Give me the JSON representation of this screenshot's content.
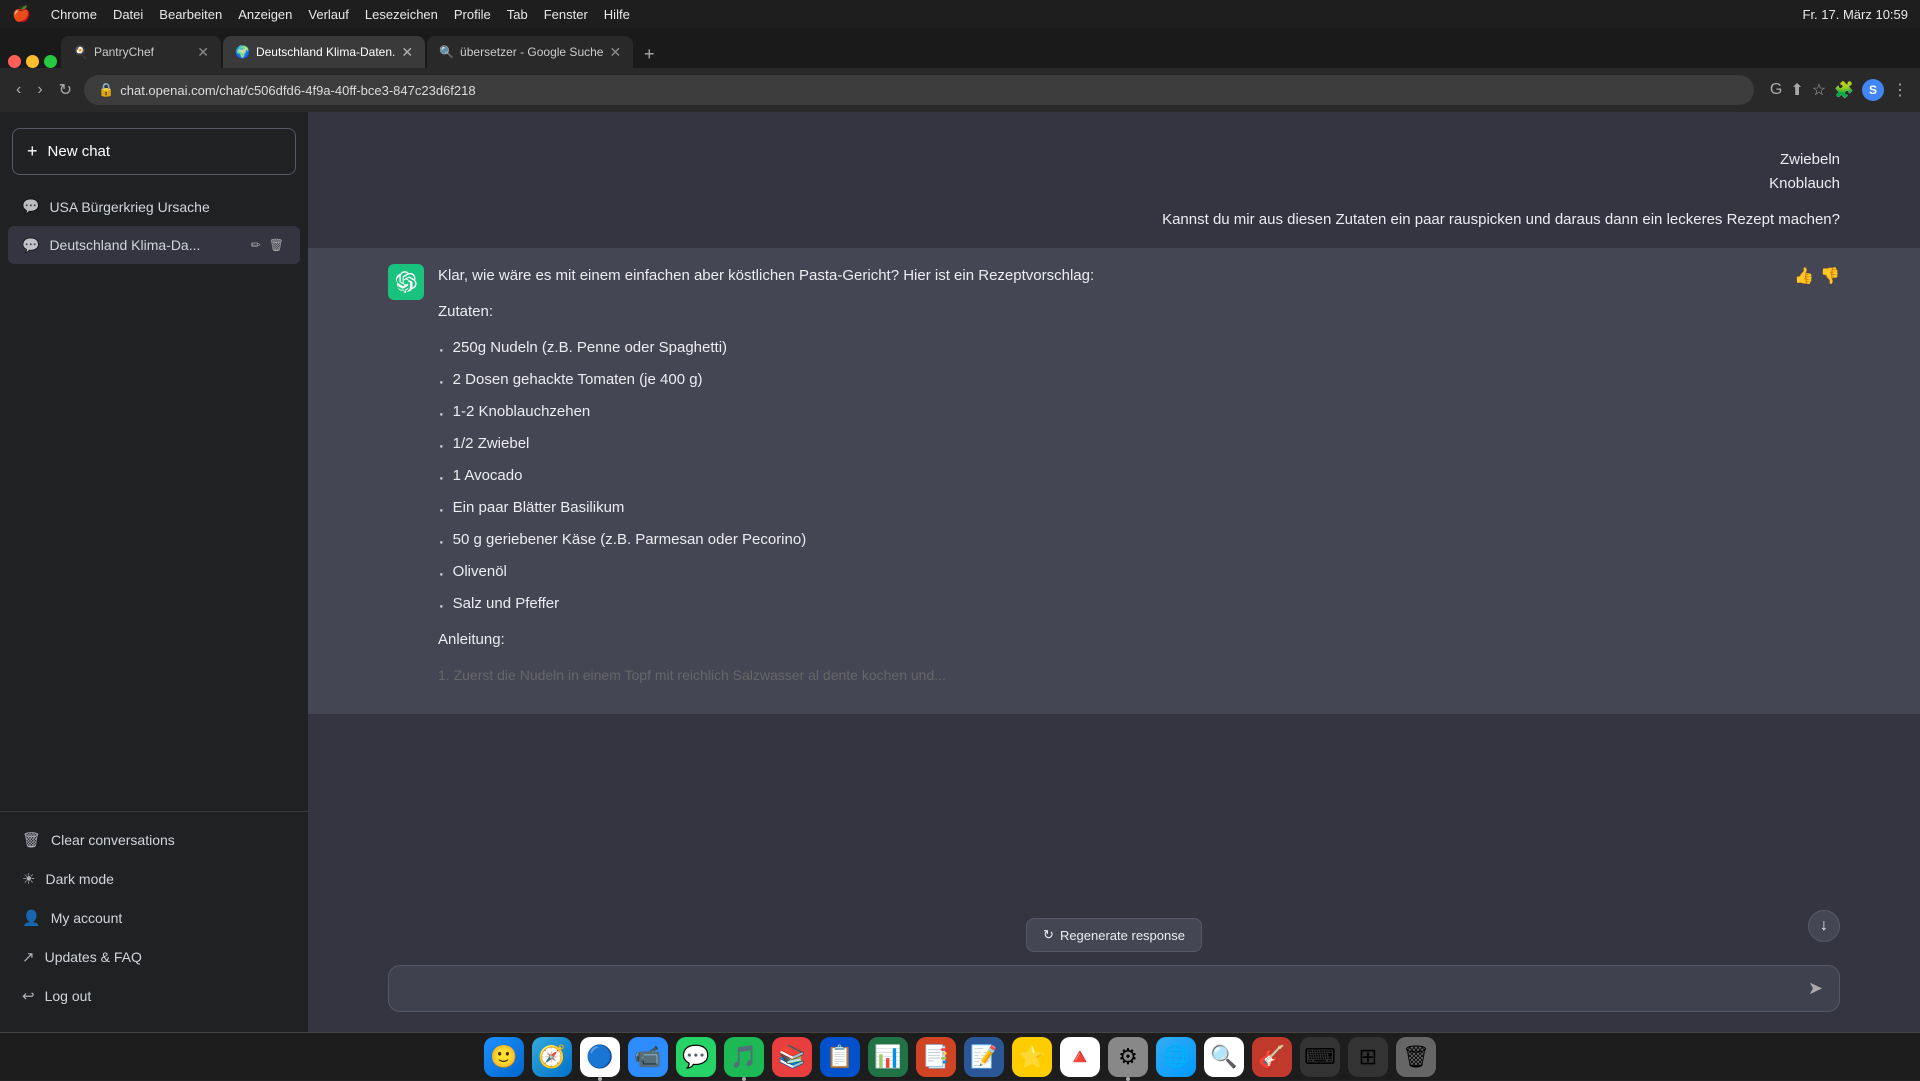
{
  "menubar": {
    "apple": "🍎",
    "items": [
      "Chrome",
      "Datei",
      "Bearbeiten",
      "Anzeigen",
      "Verlauf",
      "Lesezeichen",
      "Profile",
      "Tab",
      "Fenster",
      "Hilfe"
    ],
    "right": "Fr. 17. März  10:59"
  },
  "browser": {
    "tabs": [
      {
        "id": "pantry",
        "title": "PantryChef",
        "active": false,
        "favicon": "🍳"
      },
      {
        "id": "klima",
        "title": "Deutschland Klima-Daten.",
        "active": true,
        "favicon": "🌍"
      },
      {
        "id": "uebersetzer",
        "title": "übersetzer - Google Suche",
        "active": false,
        "favicon": "🔍"
      }
    ],
    "url": "chat.openai.com/chat/c506dfd6-4f9a-40ff-bce3-847c23d6f218"
  },
  "sidebar": {
    "new_chat_label": "New chat",
    "chats": [
      {
        "id": "usa",
        "title": "USA Bürgerkrieg Ursache",
        "active": false
      },
      {
        "id": "deutschland",
        "title": "Deutschland Klima-Da...",
        "active": true
      }
    ],
    "bottom_items": [
      {
        "id": "clear",
        "icon": "🗑",
        "label": "Clear conversations"
      },
      {
        "id": "dark",
        "icon": "☀",
        "label": "Dark mode"
      },
      {
        "id": "account",
        "icon": "👤",
        "label": "My account"
      },
      {
        "id": "updates",
        "icon": "↗",
        "label": "Updates & FAQ"
      },
      {
        "id": "logout",
        "icon": "↩",
        "label": "Log out"
      }
    ]
  },
  "chat": {
    "user_message": "Zwiebeln\nKnoblauch\n\nKannst du mir aus diesen Zutaten ein paar rauspicken und daraus dann ein leckeres Rezept machen?",
    "assistant_message": {
      "intro": "Klar, wie wäre es mit einem einfachen aber köstlichen Pasta-Gericht? Hier ist ein Rezeptvorschlag:",
      "zutaten_label": "Zutaten:",
      "ingredients": [
        "250g Nudeln (z.B. Penne oder Spaghetti)",
        "2 Dosen gehackte Tomaten (je 400 g)",
        "1-2 Knoblauchzehen",
        "1/2 Zwiebel",
        "1 Avocado",
        "Ein paar Blätter Basilikum",
        "50 g geriebener Käse (z.B. Parmesan oder Pecorino)",
        "Olivenöl",
        "Salz und Pfeffer"
      ],
      "anleitung_label": "Anleitung:",
      "partial_step": "1.  Zuerst die Nudeln in einem Topf mit reichlich Salzwasser al dente kochen und..."
    }
  },
  "input": {
    "placeholder": ""
  },
  "regenerate_label": "Regenerate response",
  "dock": {
    "items": [
      {
        "id": "finder",
        "emoji": "😊",
        "color": "#1e7bf5",
        "active": false
      },
      {
        "id": "safari",
        "emoji": "🧭",
        "color": "#0a84ff",
        "active": false
      },
      {
        "id": "chrome",
        "emoji": "🔵",
        "color": "#ea4335",
        "active": true
      },
      {
        "id": "zoom",
        "emoji": "💙",
        "color": "#2d8cff",
        "active": false
      },
      {
        "id": "whatsapp",
        "emoji": "💬",
        "color": "#25d366",
        "active": false
      },
      {
        "id": "spotify",
        "emoji": "🎵",
        "color": "#1db954",
        "active": true
      },
      {
        "id": "stacks",
        "emoji": "📚",
        "color": "#e83e3e",
        "active": false
      },
      {
        "id": "trello",
        "emoji": "📋",
        "color": "#0052cc",
        "active": false
      },
      {
        "id": "excel",
        "emoji": "📊",
        "color": "#217346",
        "active": false
      },
      {
        "id": "powerpoint",
        "emoji": "📑",
        "color": "#d04423",
        "active": false
      },
      {
        "id": "word",
        "emoji": "📝",
        "color": "#2b5797",
        "active": false
      },
      {
        "id": "notes",
        "emoji": "⭐",
        "color": "#ffcc00",
        "active": false
      },
      {
        "id": "gdrive",
        "emoji": "🔺",
        "color": "#4285f4",
        "active": false
      },
      {
        "id": "settings",
        "emoji": "⚙",
        "color": "#888",
        "active": false
      },
      {
        "id": "maps",
        "emoji": "🌐",
        "color": "#34adf4",
        "active": false
      },
      {
        "id": "finder2",
        "emoji": "🔍",
        "color": "#e84",
        "active": false
      },
      {
        "id": "music",
        "emoji": "🎸",
        "color": "#c0392b",
        "active": false
      },
      {
        "id": "control",
        "emoji": "⌨",
        "color": "#555",
        "active": false
      },
      {
        "id": "missions",
        "emoji": "⊞",
        "color": "#555",
        "active": false
      },
      {
        "id": "trash",
        "emoji": "🗑",
        "color": "#888",
        "active": false
      }
    ]
  }
}
